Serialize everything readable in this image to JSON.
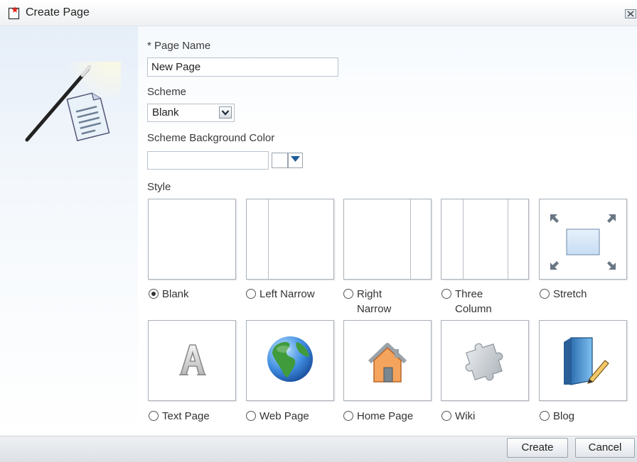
{
  "dialog": {
    "title": "Create Page"
  },
  "form": {
    "page_name_label": "* Page Name",
    "page_name_value": "New Page",
    "scheme_label": "Scheme",
    "scheme_value": "Blank",
    "bg_color_label": "Scheme Background Color",
    "bg_color_value": "",
    "style_label": "Style"
  },
  "styles": [
    {
      "label": "Blank",
      "selected": true
    },
    {
      "label": "Left Narrow",
      "selected": false
    },
    {
      "label": "Right Narrow",
      "selected": false
    },
    {
      "label": "Three Column",
      "selected": false
    },
    {
      "label": "Stretch",
      "selected": false
    },
    {
      "label": "Text Page",
      "selected": false
    },
    {
      "label": "Web Page",
      "selected": false
    },
    {
      "label": "Home Page",
      "selected": false
    },
    {
      "label": "Wiki",
      "selected": false
    },
    {
      "label": "Blog",
      "selected": false
    }
  ],
  "buttons": {
    "create": "Create",
    "cancel": "Cancel"
  },
  "colors": {
    "border": "#a8b0b9",
    "accent": "#1f5c99"
  }
}
